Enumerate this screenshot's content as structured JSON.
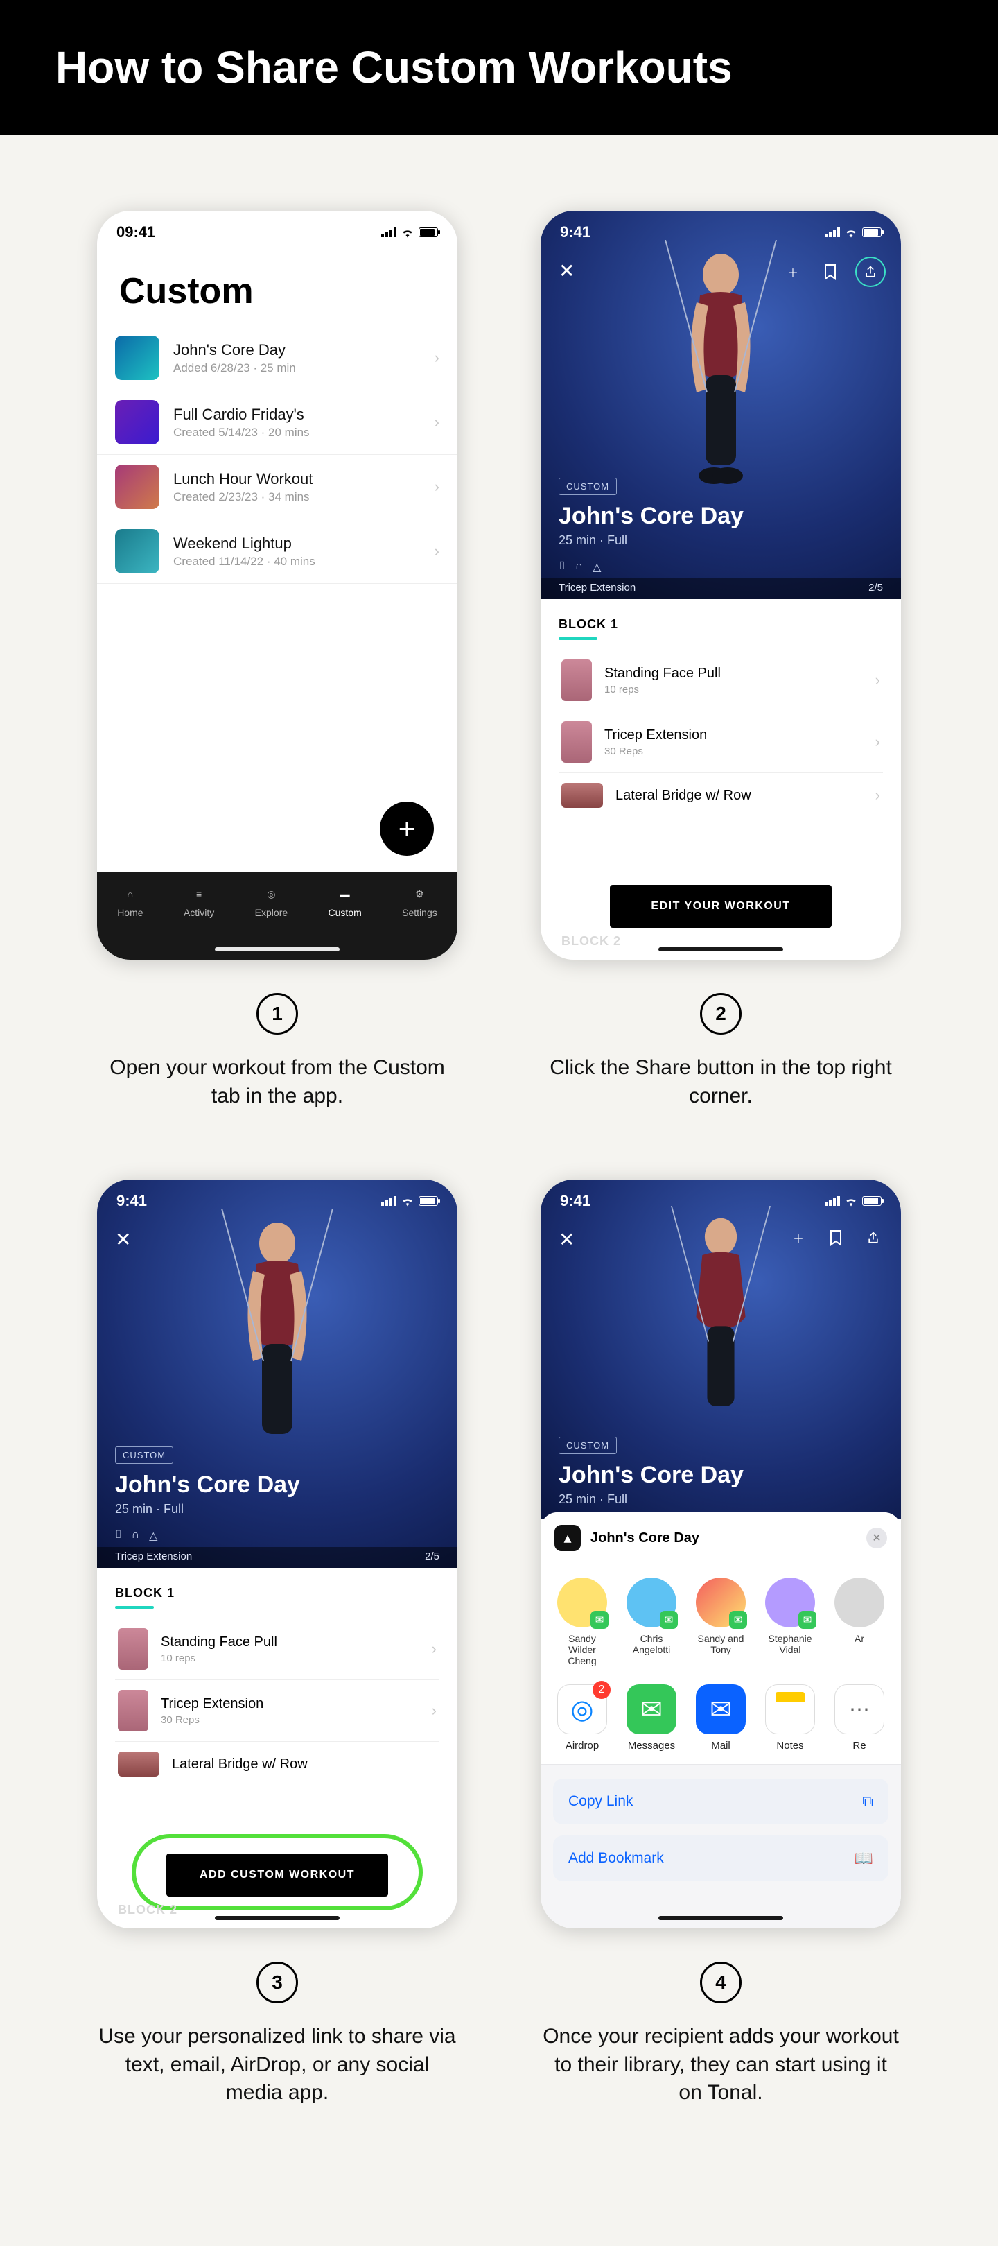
{
  "header": {
    "title": "How to Share Custom Workouts"
  },
  "steps": [
    {
      "num": "1",
      "caption": "Open your workout from the Custom tab in the app."
    },
    {
      "num": "2",
      "caption": "Click the Share button in the top right corner."
    },
    {
      "num": "3",
      "caption": "Use your personalized link to share via text, email, AirDrop, or any social media app."
    },
    {
      "num": "4",
      "caption": "Once your recipient adds your workout to their library, they can start using it on Tonal."
    }
  ],
  "phone1": {
    "time": "09:41",
    "title": "Custom",
    "workouts": [
      {
        "name": "John's Core Day",
        "sub": "Added 6/28/23 · 25 min"
      },
      {
        "name": "Full Cardio Friday's",
        "sub": "Created 5/14/23 · 20 mins"
      },
      {
        "name": "Lunch Hour Workout",
        "sub": "Created 2/23/23 · 34 mins"
      },
      {
        "name": "Weekend Lightup",
        "sub": "Created 11/14/22 · 40 mins"
      }
    ],
    "tabs": {
      "home": "Home",
      "activity": "Activity",
      "explore": "Explore",
      "custom": "Custom",
      "settings": "Settings"
    }
  },
  "detail": {
    "time": "9:41",
    "badge": "CUSTOM",
    "title": "John's Core Day",
    "meta": "25 min · Full",
    "caption_exercise": "Tricep Extension",
    "caption_count": "2/5",
    "block_label": "BLOCK 1",
    "exercises": [
      {
        "name": "Standing Face Pull",
        "sub": "10 reps"
      },
      {
        "name": "Tricep Extension",
        "sub": "30 Reps"
      },
      {
        "name": "Lateral Bridge w/ Row",
        "sub": ""
      }
    ],
    "edit_btn": "EDIT YOUR WORKOUT",
    "add_btn": "ADD CUSTOM WORKOUT",
    "block2": "BLOCK 2"
  },
  "share": {
    "sheet_title": "John's Core Day",
    "contacts": [
      {
        "name": "Sandy Wilder Cheng"
      },
      {
        "name": "Chris Angelotti"
      },
      {
        "name": "Sandy and Tony"
      },
      {
        "name": "Stephanie Vidal"
      },
      {
        "name": "Ar"
      }
    ],
    "apps": [
      {
        "name": "Airdrop",
        "badge": "2"
      },
      {
        "name": "Messages"
      },
      {
        "name": "Mail"
      },
      {
        "name": "Notes"
      },
      {
        "name": "Re"
      }
    ],
    "actions": {
      "copy": "Copy Link",
      "bookmark": "Add Bookmark"
    }
  }
}
